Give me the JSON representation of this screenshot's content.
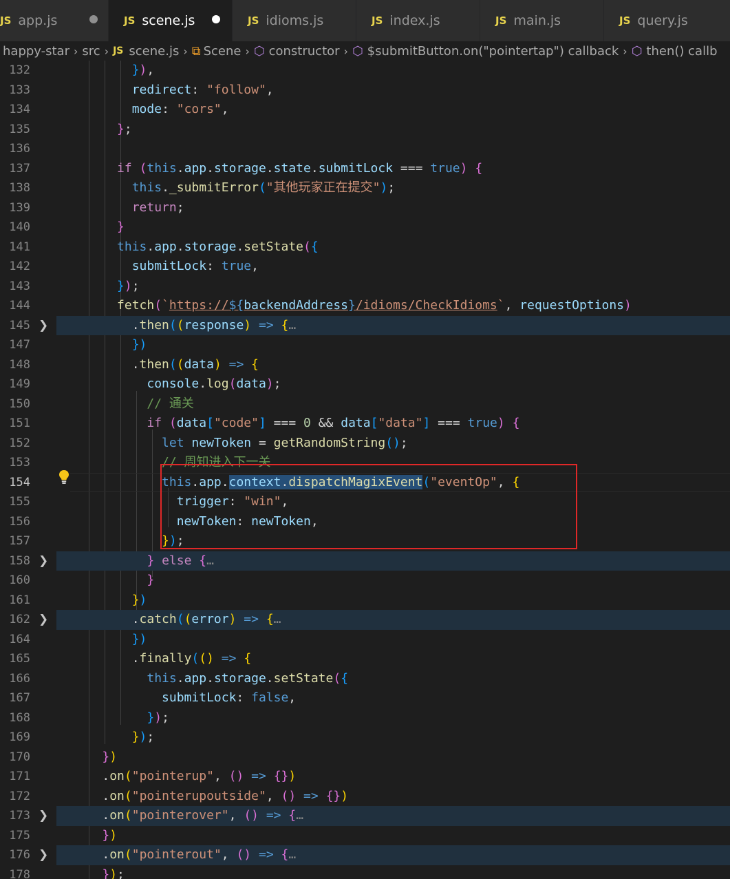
{
  "tabs": [
    {
      "label": "app.js",
      "icon": "JS",
      "modified": true,
      "active": false
    },
    {
      "label": "scene.js",
      "icon": "JS",
      "modified": true,
      "active": true
    },
    {
      "label": "idioms.js",
      "icon": "JS",
      "modified": false,
      "active": false
    },
    {
      "label": "index.js",
      "icon": "JS",
      "modified": false,
      "active": false
    },
    {
      "label": "main.js",
      "icon": "JS",
      "modified": false,
      "active": false
    },
    {
      "label": "query.js",
      "icon": "JS",
      "modified": false,
      "active": false
    }
  ],
  "breadcrumb": {
    "project": "happy-star",
    "folder": "src",
    "file": "scene.js",
    "file_icon": "JS",
    "class": "Scene",
    "method": "constructor",
    "callback": "$submitButton.on(\"pointertap\") callback",
    "then": "then() callb"
  },
  "line_numbers": [
    "132",
    "133",
    "134",
    "135",
    "136",
    "137",
    "138",
    "139",
    "140",
    "141",
    "142",
    "143",
    "144",
    "145",
    "147",
    "148",
    "149",
    "150",
    "151",
    "152",
    "153",
    "154",
    "155",
    "156",
    "157",
    "158",
    "160",
    "161",
    "162",
    "164",
    "165",
    "166",
    "167",
    "168",
    "169",
    "170",
    "171",
    "172",
    "173",
    "175",
    "176",
    "178"
  ],
  "folded_lines": [
    "145",
    "158",
    "162",
    "173",
    "176"
  ],
  "current_line": "154",
  "code": {
    "l132": "}),",
    "l133_key": "redirect",
    "l133_val": "\"follow\"",
    "l134_key": "mode",
    "l134_val": "\"cors\"",
    "l137_cond": "this.app.storage.state.submitLock",
    "l138_fn": "_submitError",
    "l138_arg": "\"其他玩家正在提交\"",
    "l139": "return",
    "l141_fn": "setState",
    "l142_key": "submitLock",
    "l144_fn": "fetch",
    "l144_url_a": "https://",
    "l144_url_var": "backendAddress",
    "l144_url_b": "/idioms/CheckIdioms",
    "l144_arg": "requestOptions",
    "l145_fn": "then",
    "l145_param": "response",
    "l148_param": "data",
    "l149_fn": "log",
    "l150_comment": "// 通关",
    "l151_key1": "\"code\"",
    "l151_key2": "\"data\"",
    "l152_var": "newToken",
    "l152_fn": "getRandomString",
    "l153_comment": "// 周知进入下一关",
    "l154_sel": "context.dispatchMagixEvent",
    "l154_arg": "\"eventOp\"",
    "l155_key": "trigger",
    "l155_val": "\"win\"",
    "l156_key": "newToken",
    "l156_val": "newToken",
    "l158_kw": "else",
    "l162_fn": "catch",
    "l162_param": "error",
    "l165_fn": "finally",
    "l166_fn": "setState",
    "l167_key": "submitLock",
    "l171_evt": "\"pointerup\"",
    "l172_evt": "\"pointerupoutside\"",
    "l173_evt": "\"pointerover\"",
    "l176_evt": "\"pointerout\"",
    "ellipsis": "…"
  }
}
